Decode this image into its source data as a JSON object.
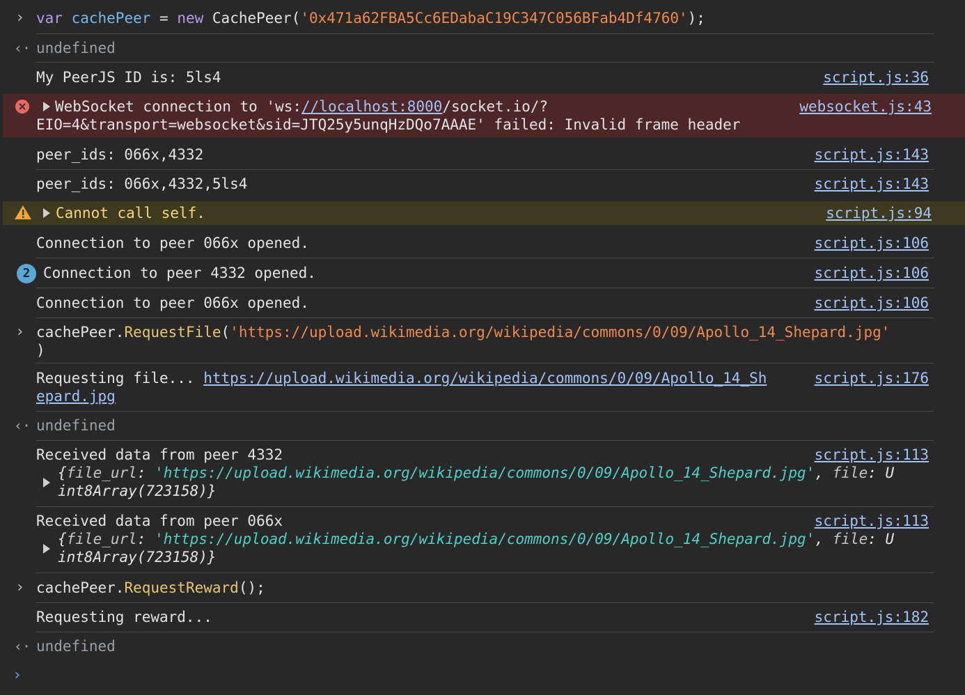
{
  "input1": {
    "kw": "var",
    "name": "cachePeer",
    "eq": " = ",
    "kw2": "new",
    "cls": " CachePeer(",
    "arg": "'0x471a62FBA5Cc6EDabaC19C347C056BFab4Df4760'",
    "tail": ");"
  },
  "result1": "undefined",
  "log1": {
    "text": "My PeerJS ID is: 5ls4",
    "source": "script.js:36"
  },
  "error1": {
    "prefix": "WebSocket connection to 'ws:",
    "link": "//localhost:8000",
    "rest": "/socket.io/?",
    "line2": "EIO=4&transport=websocket&sid=JTQ25y5unqHzDQo7AAAE' failed: Invalid frame header",
    "source": "websocket.js:43"
  },
  "log2": {
    "text": "peer_ids: 066x,4332",
    "source": "script.js:143"
  },
  "log3": {
    "text": "peer_ids: 066x,4332,5ls4",
    "source": "script.js:143"
  },
  "warn1": {
    "text": "Cannot call self.",
    "source": "script.js:94"
  },
  "log4": {
    "text": "Connection to peer 066x opened.",
    "source": "script.js:106"
  },
  "log5": {
    "count": "2",
    "text": "Connection to peer 4332 opened.",
    "source": "script.js:106"
  },
  "log6": {
    "text": "Connection to peer 066x opened.",
    "source": "script.js:106"
  },
  "input2": {
    "obj": "cachePeer.",
    "fn": "RequestFile",
    "open": "(",
    "arg": "'https://upload.wikimedia.org/wikipedia/commons/0/09/Apollo_14_Shepard.jpg'",
    "close": ")"
  },
  "log7": {
    "text": "Requesting file... ",
    "link1": "https://upload.wikimedia.org/wikipedia/commons/0/09/Apollo_14_Sh",
    "link2": "epard.jpg",
    "source": "script.js:176"
  },
  "result2": "undefined",
  "log8": {
    "text": "Received data from peer 4332",
    "obj_open": "{",
    "key1": "file_url",
    "colon": ": ",
    "val1": "'https://upload.wikimedia.org/wikipedia/commons/0/09/Apollo_14_Shepard.jpg'",
    "comma": ", ",
    "key2": "file",
    "val2a": ": U",
    "val2b": "int8Array(723158)}",
    "source": "script.js:113"
  },
  "log9": {
    "text": "Received data from peer 066x",
    "obj_open": "{",
    "key1": "file_url",
    "colon": ": ",
    "val1": "'https://upload.wikimedia.org/wikipedia/commons/0/09/Apollo_14_Shepard.jpg'",
    "comma": ", ",
    "key2": "file",
    "val2a": ": U",
    "val2b": "int8Array(723158)}",
    "source": "script.js:113"
  },
  "input3": {
    "obj": "cachePeer.",
    "fn": "RequestReward",
    "tail": "();"
  },
  "log10": {
    "text": "Requesting reward...",
    "source": "script.js:182"
  },
  "result3": "undefined",
  "prompt": ">"
}
